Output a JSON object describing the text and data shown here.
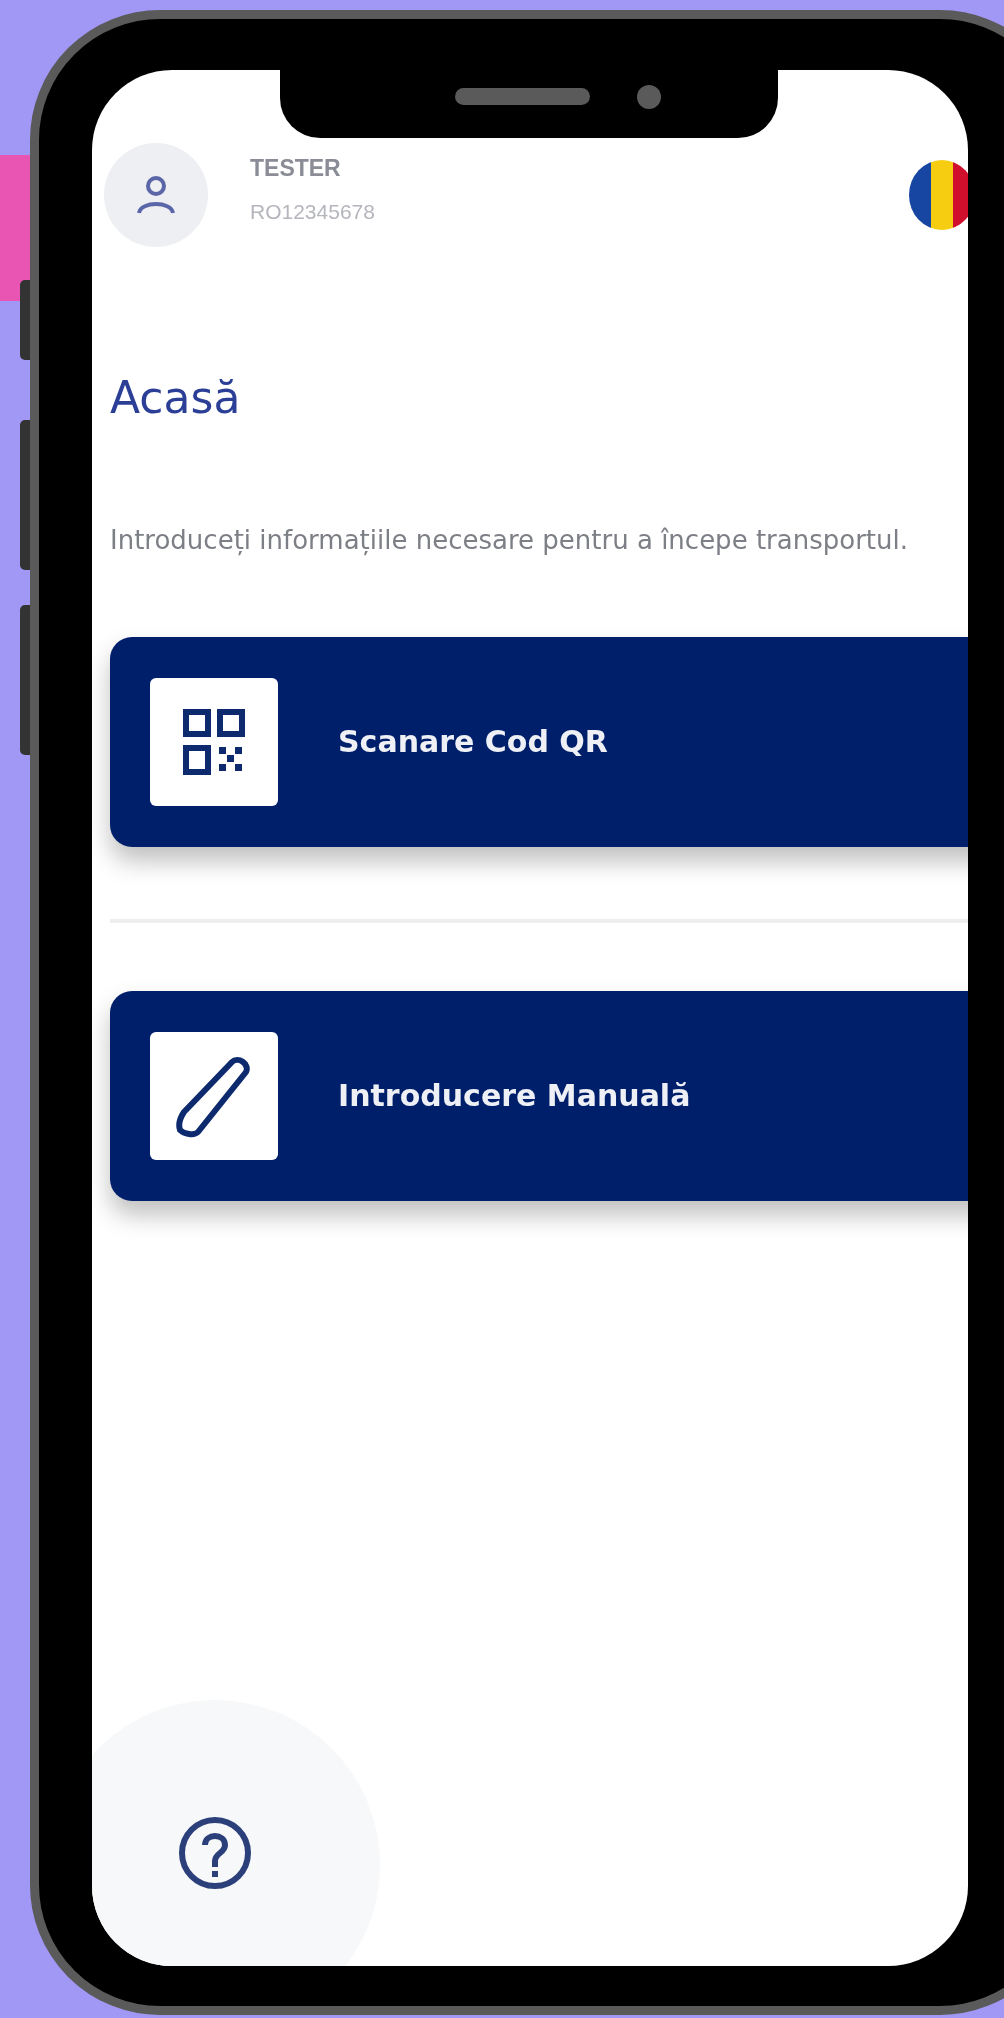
{
  "user": {
    "name": "TESTER",
    "id": "RO12345678"
  },
  "title": "Acasă",
  "description": "Introduceți informațiile necesare pentru a începe transportul.",
  "actions": [
    {
      "kind": "qr",
      "label": "Scanare Cod QR"
    },
    {
      "kind": "manual",
      "label": "Introducere Manuală"
    }
  ]
}
